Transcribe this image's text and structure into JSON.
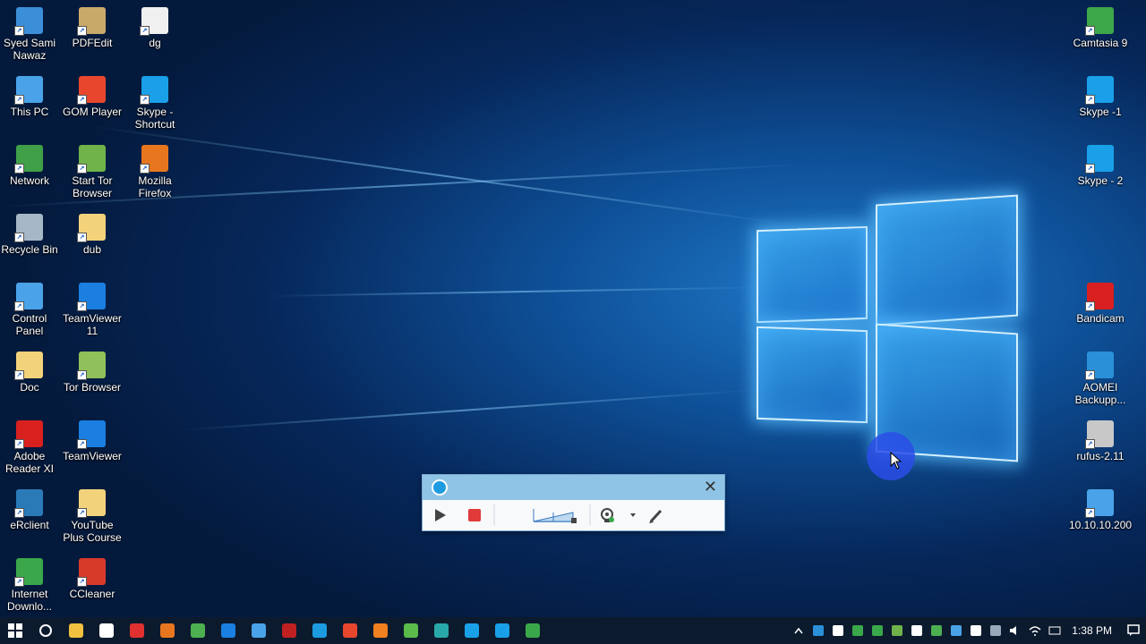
{
  "desktop": {
    "icons_left": [
      {
        "label": "Syed Sami Nawaz",
        "icon": "user-icon",
        "color": "#3b8fd8"
      },
      {
        "label": "PDFEdit",
        "icon": "pdf-edit-icon",
        "color": "#c9a96a"
      },
      {
        "label": "dg",
        "icon": "document-icon",
        "color": "#f0f0f0"
      },
      {
        "label": "This PC",
        "icon": "computer-icon",
        "color": "#4aa3e8"
      },
      {
        "label": "GOM Player",
        "icon": "gom-player-icon",
        "color": "#e8472e"
      },
      {
        "label": "Skype - Shortcut",
        "icon": "skype-icon",
        "color": "#1aa0e8"
      },
      {
        "label": "Network",
        "icon": "network-icon",
        "color": "#3fa048"
      },
      {
        "label": "Start Tor Browser",
        "icon": "tor-icon",
        "color": "#6fb34a"
      },
      {
        "label": "Mozilla Firefox",
        "icon": "firefox-icon",
        "color": "#e8761e"
      },
      {
        "label": "Recycle Bin",
        "icon": "recycle-bin-icon",
        "color": "#a6b8c8"
      },
      {
        "label": "dub",
        "icon": "folder-icon",
        "color": "#f2d27a"
      },
      {
        "label": "Control Panel",
        "icon": "control-panel-icon",
        "color": "#4aa3e8"
      },
      {
        "label": "TeamViewer 11",
        "icon": "teamviewer-icon",
        "color": "#1a7fe0"
      },
      {
        "label": "Doc",
        "icon": "folder-icon",
        "color": "#f2d27a"
      },
      {
        "label": "Tor Browser",
        "icon": "folder-icon",
        "color": "#8fc05a"
      },
      {
        "label": "Adobe Reader XI",
        "icon": "adobe-reader-icon",
        "color": "#d8201e"
      },
      {
        "label": "TeamViewer",
        "icon": "teamviewer-icon",
        "color": "#1a7fe0"
      },
      {
        "label": "eRclient",
        "icon": "erclient-icon",
        "color": "#2a7ab8"
      },
      {
        "label": "YouTube Plus Course",
        "icon": "folder-icon",
        "color": "#f2d27a"
      },
      {
        "label": "Internet Downlo...",
        "icon": "idm-icon",
        "color": "#3aa84a"
      },
      {
        "label": "CCleaner",
        "icon": "ccleaner-icon",
        "color": "#d83a2a"
      }
    ],
    "icons_right": [
      {
        "label": "Camtasia 9",
        "icon": "camtasia-icon",
        "color": "#3ca84a"
      },
      {
        "label": "Skype -1",
        "icon": "skype-icon",
        "color": "#1aa0e8"
      },
      {
        "label": "Skype - 2",
        "icon": "skype-icon",
        "color": "#1aa0e8"
      },
      {
        "label": "Bandicam",
        "icon": "bandicam-icon",
        "color": "#d82020"
      },
      {
        "label": "AOMEI Backupp...",
        "icon": "aomei-icon",
        "color": "#2a90d8"
      },
      {
        "label": "rufus-2.11",
        "icon": "usb-drive-icon",
        "color": "#c8c8c8"
      },
      {
        "label": "10.10.10.200",
        "icon": "remote-desktop-icon",
        "color": "#4aa3e8"
      }
    ]
  },
  "recorder": {
    "title_icon": "camtasia-recorder-icon",
    "buttons": [
      "play-icon",
      "stop-icon",
      "audio-level-icon",
      "webcam-icon",
      "dropdown-arrow-icon",
      "pen-icon"
    ],
    "close_glyph": "✕",
    "stop_color": "#e03a3a"
  },
  "taskbar": {
    "pinned": [
      {
        "icon": "file-explorer-icon",
        "color": "#f0c040"
      },
      {
        "icon": "store-icon",
        "color": "#ffffff"
      },
      {
        "icon": "app-red-icon",
        "color": "#e03030"
      },
      {
        "icon": "firefox-icon",
        "color": "#e8761e"
      },
      {
        "icon": "chrome-icon",
        "color": "#4caf50"
      },
      {
        "icon": "teamviewer-icon",
        "color": "#1a7fe0"
      },
      {
        "icon": "remote-desktop-icon",
        "color": "#4aa3e8"
      },
      {
        "icon": "bandicam-icon",
        "color": "#c02020"
      },
      {
        "icon": "camtasia-recorder-icon",
        "color": "#1d9be0"
      },
      {
        "icon": "gom-player-icon",
        "color": "#e8472e"
      },
      {
        "icon": "vlc-icon",
        "color": "#f08020"
      },
      {
        "icon": "utorrent-icon",
        "color": "#5aba4a"
      },
      {
        "icon": "app-teal-icon",
        "color": "#28a8a8"
      },
      {
        "icon": "skype-icon",
        "color": "#1aa0e8"
      },
      {
        "icon": "skype-icon",
        "color": "#1aa0e8"
      },
      {
        "icon": "idm-icon",
        "color": "#3aa84a"
      }
    ],
    "tray": [
      "chevron-up-icon",
      "tray-app-icon",
      "tray-app-icon",
      "tray-app-icon",
      "tray-app-icon",
      "tray-app-icon",
      "tray-app-icon",
      "tray-app-icon",
      "chrome-icon",
      "tray-app-icon",
      "network-icon",
      "volume-icon",
      "wifi-icon",
      "keyboard-icon"
    ],
    "time": "1:38 PM",
    "notification_icon": "action-center-icon"
  },
  "cursor": {
    "highlight_color": "#2a4ee8"
  }
}
